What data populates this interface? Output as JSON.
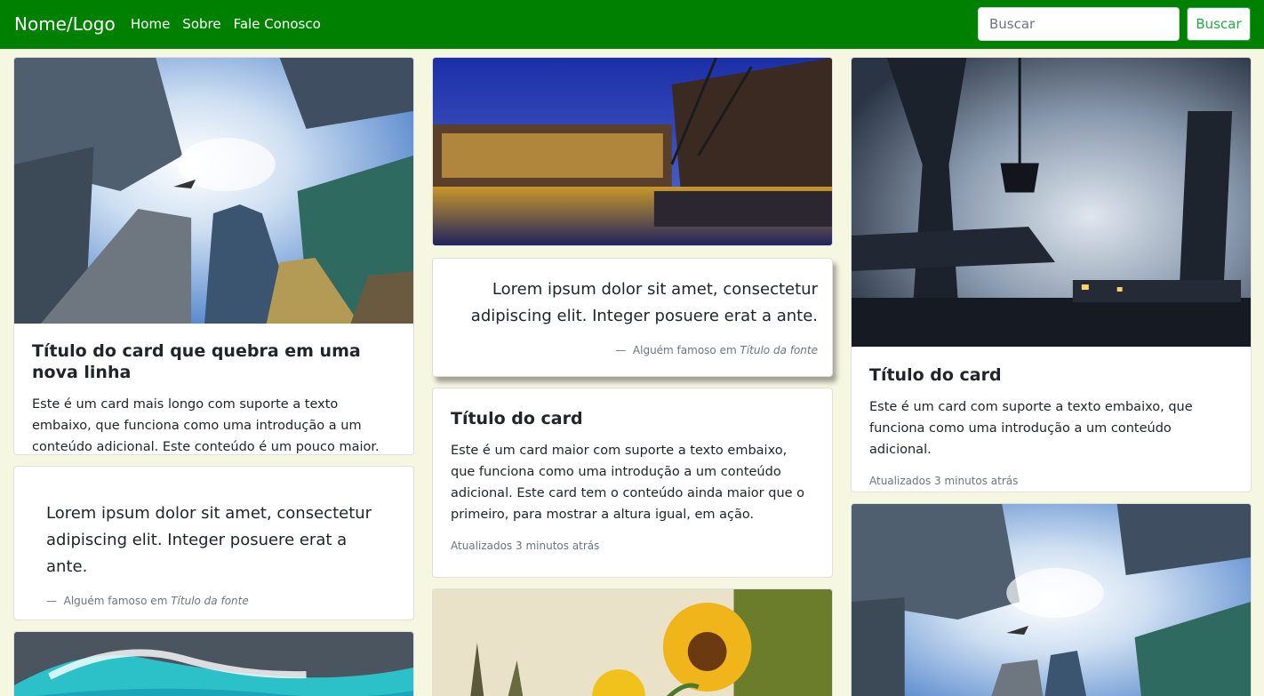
{
  "navbar": {
    "brand": "Nome/Logo",
    "links": [
      "Home",
      "Sobre",
      "Fale Conosco"
    ],
    "search_placeholder": "Buscar",
    "search_button": "Buscar"
  },
  "colors": {
    "navbar_bg": "#008000",
    "page_bg": "#f5f7e1",
    "button_outline": "#28a745"
  },
  "cards": {
    "c1": {
      "image": "skyscrapers-photo",
      "title": "Título do card que quebra em uma nova linha",
      "text": "Este é um card mais longo com suporte a texto embaixo, que funciona como uma introdução a um conteúdo adicional. Este conteúdo é um pouco maior."
    },
    "c2": {
      "quote": "Lorem ipsum dolor sit amet, consectetur adipiscing elit. Integer posuere erat a ante.",
      "footer_prefix": "Alguém famoso em",
      "footer_cite": "Título da fonte"
    },
    "c3": {
      "image": "ocean-wave-photo"
    },
    "c4": {
      "image": "canal-night-photo"
    },
    "c5": {
      "quote": "Lorem ipsum dolor sit amet, consectetur adipiscing elit. Integer posuere erat a ante.",
      "footer_prefix": "Alguém famoso em",
      "footer_cite": "Título da fonte"
    },
    "c6": {
      "title": "Título do card",
      "text": "Este é um card maior com suporte a texto embaixo, que funciona como uma introdução a um conteúdo adicional. Este card tem o conteúdo ainda maior que o primeiro, para mostrar a altura igual, em ação.",
      "updated": "Atualizados 3 minutos atrás"
    },
    "c7": {
      "image": "sunflower-photo"
    },
    "c8": {
      "image": "industrial-cranes-photo",
      "title": "Título do card",
      "text": "Este é um card com suporte a texto embaixo, que funciona como uma introdução a um conteúdo adicional.",
      "updated": "Atualizados 3 minutos atrás"
    },
    "c9": {
      "image": "skyscrapers-photo"
    }
  }
}
